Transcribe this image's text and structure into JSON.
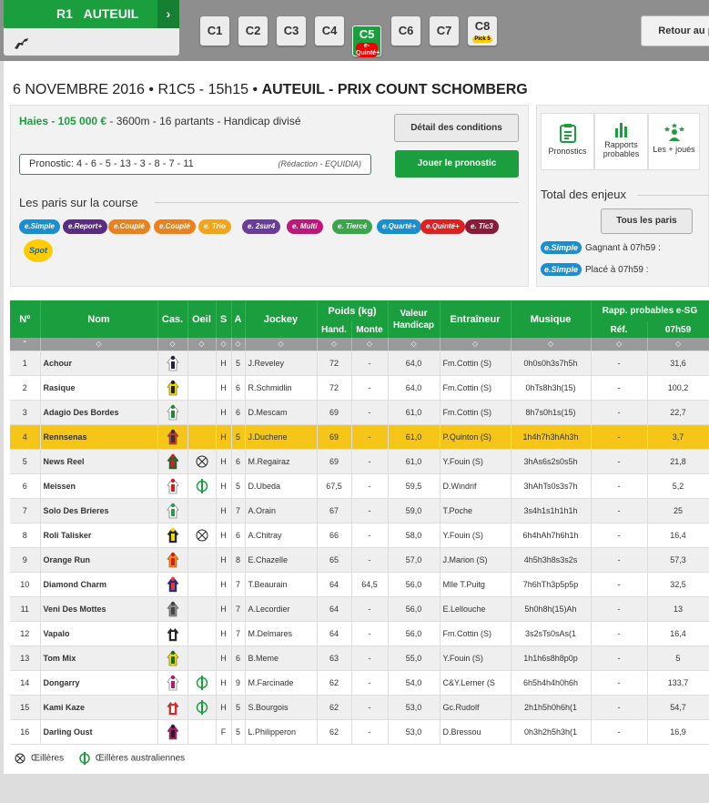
{
  "nav": {
    "reunion": "R1",
    "hippodrome": "AUTEUIL",
    "courses": [
      {
        "label": "C1"
      },
      {
        "label": "C2"
      },
      {
        "label": "C3"
      },
      {
        "label": "C4"
      },
      {
        "label": "C5",
        "sub": "e-Quinté+",
        "active": true
      },
      {
        "label": "C6"
      },
      {
        "label": "C7"
      },
      {
        "label": "C8",
        "sub": "Pick 5"
      }
    ],
    "retour": "Retour au pr"
  },
  "header": {
    "date_line": "6 NOVEMBRE 2016 • R1C5 - 15h15 • ",
    "race": "AUTEUIL - PRIX COUNT SCHOMBERG"
  },
  "conditions": {
    "type_prize": "Haies - 105 000 €",
    "details": " - 3600m - 16 partants  - Handicap divisé"
  },
  "prono": {
    "label": "Pronostic: 4 - 6 - 5 - 13 - 3 - 8 - 7 - 11",
    "source": "(Rédaction - EQUIDIA)"
  },
  "buttons": {
    "detail": "Détail des conditions",
    "jouer": "Jouer le pronostic",
    "tous": "Tous les paris"
  },
  "paris": {
    "title": "Les paris sur la course",
    "types": [
      {
        "label": "e.Simple",
        "color": "#1a8fd0"
      },
      {
        "label": "e.Report+",
        "color": "#5a2d82"
      },
      {
        "label": "e.Couplé",
        "color": "#e8821e"
      },
      {
        "label": "e.Couplé",
        "color": "#e8821e"
      },
      {
        "label": "e. Trio",
        "color": "#f2a51a"
      },
      {
        "label": "e. 2sur4",
        "color": "#6a3d9a"
      },
      {
        "label": "e. Multi",
        "color": "#c0167a"
      },
      {
        "label": "e. Tiercé",
        "color": "#3ba54a"
      },
      {
        "label": "e.Quarté+",
        "color": "#1a8fd0"
      },
      {
        "label": "e.Quinté+",
        "color": "#e02020"
      },
      {
        "label": "e. Tic3",
        "color": "#8a1b3a"
      }
    ],
    "spot": "Spot"
  },
  "side": {
    "pronostics": "Pronostics",
    "rapports": "Rapports probables",
    "plusjoues": "Les + joués",
    "enjeux": "Total des enjeux",
    "esimple": "e.Simple",
    "gagnant": "Gagnant à 07h59 :",
    "place": "Placé à 07h59 :"
  },
  "table": {
    "headers": {
      "no": "Nº",
      "nom": "Nom",
      "cas": "Cas.",
      "oeil": "Oeil",
      "s": "S",
      "a": "A",
      "jockey": "Jockey",
      "poids": "Poids (kg)",
      "hand": "Hand.",
      "monte": "Monte",
      "valeur": "Valeur Handicap",
      "entraineur": "Entraîneur",
      "musique": "Musique",
      "rapp": "Rapp. probables e-SG",
      "ref": "Réf.",
      "time": "07h59"
    },
    "rows": [
      {
        "n": "1",
        "nom": "Achour",
        "oeil": "",
        "s": "H",
        "a": "5",
        "jockey": "J.Reveley",
        "hand": "72",
        "monte": "-",
        "val": "64,0",
        "ent": "Fm.Cottin (S)",
        "mus": "0h0s0h3s7h5h",
        "ref": "-",
        "cote": "31,6",
        "silk": [
          "#fff",
          "#223"
        ]
      },
      {
        "n": "2",
        "nom": "Rasique",
        "oeil": "",
        "s": "H",
        "a": "6",
        "jockey": "R.Schmidlin",
        "hand": "72",
        "monte": "-",
        "val": "64,0",
        "ent": "Fm.Cottin (S)",
        "mus": "0hTs8h3h(15)",
        "ref": "-",
        "cote": "100,2",
        "silk": [
          "#f5d800",
          "#222"
        ]
      },
      {
        "n": "3",
        "nom": "Adagio Des Bordes",
        "oeil": "",
        "s": "H",
        "a": "6",
        "jockey": "D.Mescam",
        "hand": "69",
        "monte": "-",
        "val": "61,0",
        "ent": "Fm.Cottin (S)",
        "mus": "8h7s0h1s(15)",
        "ref": "-",
        "cote": "22,7",
        "silk": [
          "#fff",
          "#1a8a3a"
        ]
      },
      {
        "n": "4",
        "nom": "Rennsenas",
        "oeil": "",
        "s": "H",
        "a": "5",
        "jockey": "J.Duchene",
        "hand": "69",
        "monte": "-",
        "val": "61,0",
        "ent": "P.Quinton (S)",
        "mus": "1h4h7h3hAh3h",
        "ref": "-",
        "cote": "3,7",
        "silk": [
          "#c33",
          "#333"
        ],
        "hl": true
      },
      {
        "n": "5",
        "nom": "News Reel",
        "oeil": "X",
        "s": "H",
        "a": "6",
        "jockey": "M.Regairaz",
        "hand": "69",
        "monte": "-",
        "val": "61,0",
        "ent": "Y.Fouin (S)",
        "mus": "3hAs6s2s0s5h",
        "ref": "-",
        "cote": "21,8",
        "silk": [
          "#1a6a2a",
          "#c22"
        ]
      },
      {
        "n": "6",
        "nom": "Meissen",
        "oeil": "A",
        "s": "H",
        "a": "5",
        "jockey": "D.Ubeda",
        "hand": "67,5",
        "monte": "-",
        "val": "59,5",
        "ent": "D.Windrif",
        "mus": "3hAhTs0s3s7h",
        "ref": "-",
        "cote": "5,2",
        "silk": [
          "#fff",
          "#c22"
        ]
      },
      {
        "n": "7",
        "nom": "Solo Des Brieres",
        "oeil": "",
        "s": "H",
        "a": "7",
        "jockey": "A.Orain",
        "hand": "67",
        "monte": "-",
        "val": "59,0",
        "ent": "T.Poche",
        "mus": "3s4h1s1h1h1h",
        "ref": "-",
        "cote": "25",
        "silk": [
          "#fff",
          "#2a9a4a"
        ]
      },
      {
        "n": "8",
        "nom": "Roli Talisker",
        "oeil": "X",
        "s": "H",
        "a": "6",
        "jockey": "A.Chitray",
        "hand": "66",
        "monte": "-",
        "val": "58,0",
        "ent": "Y.Fouin (S)",
        "mus": "6h4hAh7h6h1h",
        "ref": "-",
        "cote": "16,4",
        "silk": [
          "#222",
          "#f5d800"
        ]
      },
      {
        "n": "9",
        "nom": "Orange Run",
        "oeil": "",
        "s": "H",
        "a": "8",
        "jockey": "E.Chazelle",
        "hand": "65",
        "monte": "-",
        "val": "57,0",
        "ent": "J.Marion (S)",
        "mus": "4h5h3h8s3s2s",
        "ref": "-",
        "cote": "57,3",
        "silk": [
          "#f80",
          "#c22"
        ]
      },
      {
        "n": "10",
        "nom": "Diamond Charm",
        "oeil": "",
        "s": "H",
        "a": "7",
        "jockey": "T.Beaurain",
        "hand": "64",
        "monte": "64,5",
        "val": "56,0",
        "ent": "Mlle T.Puitg",
        "mus": "7h6hTh3p5p5p",
        "ref": "-",
        "cote": "32,5",
        "silk": [
          "#1a2a8a",
          "#e33"
        ]
      },
      {
        "n": "11",
        "nom": "Veni Des Mottes",
        "oeil": "",
        "s": "H",
        "a": "7",
        "jockey": "A.Lecordier",
        "hand": "64",
        "monte": "-",
        "val": "56,0",
        "ent": "E.Lellouche",
        "mus": "5h0h8h(15)Ah",
        "ref": "-",
        "cote": "13",
        "silk": [
          "#888",
          "#444"
        ]
      },
      {
        "n": "12",
        "nom": "Vapalo",
        "oeil": "",
        "s": "H",
        "a": "7",
        "jockey": "M.Delmares",
        "hand": "64",
        "monte": "-",
        "val": "56,0",
        "ent": "Fm.Cottin (S)",
        "mus": "3s2sTs0sAs(1",
        "ref": "-",
        "cote": "16,4",
        "silk": [
          "#222",
          "#fff"
        ]
      },
      {
        "n": "13",
        "nom": "Tom Mix",
        "oeil": "",
        "s": "H",
        "a": "6",
        "jockey": "B.Meme",
        "hand": "63",
        "monte": "-",
        "val": "55,0",
        "ent": "Y.Fouin (S)",
        "mus": "1h1h6s8h8p0p",
        "ref": "-",
        "cote": "5",
        "silk": [
          "#f5d800",
          "#1a6a2a"
        ]
      },
      {
        "n": "14",
        "nom": "Dongarry",
        "oeil": "A",
        "s": "H",
        "a": "9",
        "jockey": "M.Farcinade",
        "hand": "62",
        "monte": "-",
        "val": "54,0",
        "ent": "C&Y.Lerner (S",
        "mus": "6h5h4h4h0h6h",
        "ref": "-",
        "cote": "133,7",
        "silk": [
          "#fff",
          "#b01a6a"
        ]
      },
      {
        "n": "15",
        "nom": "Kami Kaze",
        "oeil": "A",
        "s": "H",
        "a": "5",
        "jockey": "S.Bourgois",
        "hand": "62",
        "monte": "-",
        "val": "53,0",
        "ent": "Gc.Rudolf",
        "mus": "2h1h5h0h6h(1",
        "ref": "-",
        "cote": "54,7",
        "silk": [
          "#e22",
          "#fff"
        ]
      },
      {
        "n": "16",
        "nom": "Darling Oust",
        "oeil": "",
        "s": "F",
        "a": "5",
        "jockey": "L.Philipperon",
        "hand": "62",
        "monte": "-",
        "val": "53,0",
        "ent": "D.Bressou",
        "mus": "0h3h2h5h3h(1",
        "ref": "-",
        "cote": "16,9",
        "silk": [
          "#b01a6a",
          "#222"
        ]
      }
    ]
  },
  "legend": {
    "oeilleres": "Œillères",
    "australiennes": "Œillères australiennes"
  },
  "colors": {
    "green": "#1a9e3e",
    "highlight": "#f5c518"
  }
}
